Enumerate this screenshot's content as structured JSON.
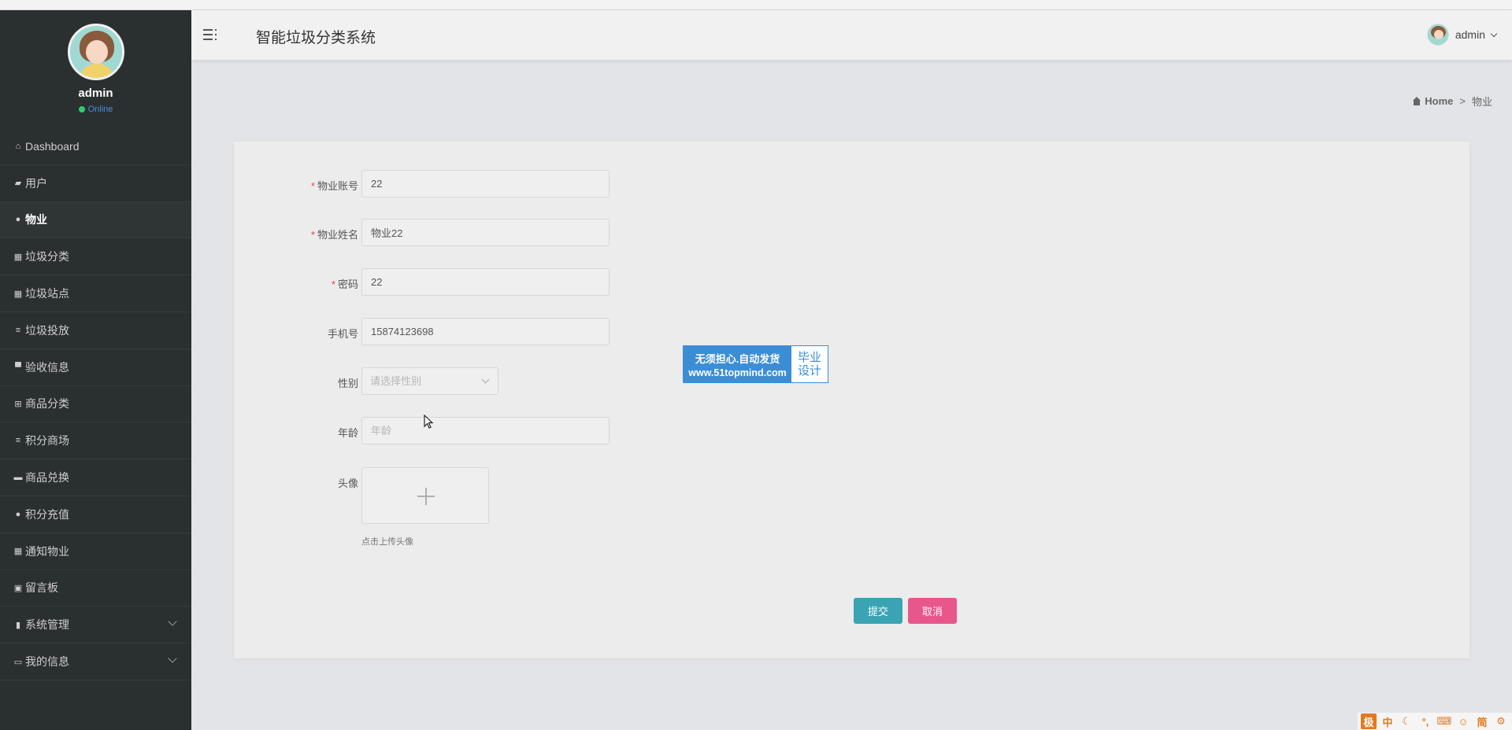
{
  "profile": {
    "name": "admin",
    "status": "Online"
  },
  "sidebar": {
    "items": [
      {
        "label": "Dashboard",
        "icon": "home-icon",
        "glyph": "⌂"
      },
      {
        "label": "用户",
        "icon": "users-icon",
        "glyph": "▰"
      },
      {
        "label": "物业",
        "icon": "user-icon",
        "glyph": "●"
      },
      {
        "label": "垃圾分类",
        "icon": "grid-icon",
        "glyph": "▦"
      },
      {
        "label": "垃圾站点",
        "icon": "grid-icon",
        "glyph": "▦"
      },
      {
        "label": "垃圾投放",
        "icon": "list-icon",
        "glyph": "≡"
      },
      {
        "label": "验收信息",
        "icon": "monitor-icon",
        "glyph": "▀"
      },
      {
        "label": "商品分类",
        "icon": "table-icon",
        "glyph": "⊞"
      },
      {
        "label": "积分商场",
        "icon": "list-icon",
        "glyph": "≡"
      },
      {
        "label": "商品兑换",
        "icon": "ticket-icon",
        "glyph": "▬"
      },
      {
        "label": "积分充值",
        "icon": "user-icon",
        "glyph": "●"
      },
      {
        "label": "通知物业",
        "icon": "grid-icon",
        "glyph": "▦"
      },
      {
        "label": "留言板",
        "icon": "clipboard-icon",
        "glyph": "▣"
      },
      {
        "label": "系统管理",
        "icon": "bar-chart-icon",
        "glyph": "▮"
      },
      {
        "label": "我的信息",
        "icon": "card-icon",
        "glyph": "▭"
      }
    ]
  },
  "header": {
    "title": "智能垃圾分类系统",
    "user": "admin"
  },
  "breadcrumb": {
    "home": "Home",
    "separator": ">",
    "current": "物业"
  },
  "form": {
    "account": {
      "label": "物业账号",
      "value": "22"
    },
    "name": {
      "label": "物业姓名",
      "value": "物业22"
    },
    "password": {
      "label": "密码",
      "value": "22"
    },
    "phone": {
      "label": "手机号",
      "value": "15874123698"
    },
    "gender": {
      "label": "性别",
      "placeholder": "请选择性别"
    },
    "age": {
      "label": "年龄",
      "placeholder": "年龄"
    },
    "avatar": {
      "label": "头像",
      "hint": "点击上传头像"
    },
    "submit_label": "提交",
    "cancel_label": "取消"
  },
  "watermark": {
    "line1": "无须担心.自动发货",
    "line2": "www.51topmind.com",
    "right1": "毕业",
    "right2": "设计"
  },
  "ime_tray": [
    "中",
    "☾",
    "°,",
    "⌨",
    "☺",
    "简",
    "⚙"
  ],
  "colors": {
    "sidebar": "#2a2f2f",
    "submit": "#3aa4b4",
    "cancel": "#e8578a",
    "accent": "#3b8ed6"
  }
}
